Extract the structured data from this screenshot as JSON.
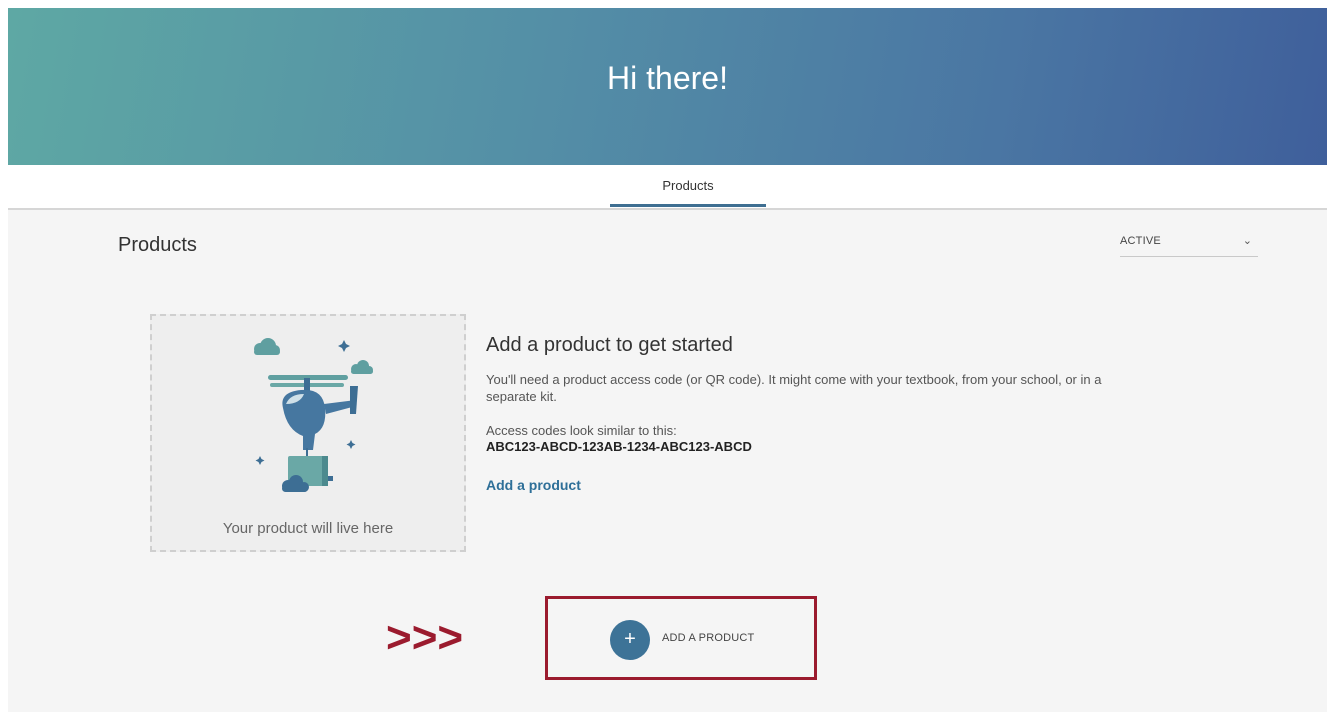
{
  "hero": {
    "title": "Hi there!"
  },
  "tabs": [
    {
      "label": "Products",
      "active": true
    }
  ],
  "section": {
    "title": "Products"
  },
  "filter": {
    "value": "ACTIVE",
    "icon": "chevron-down-icon"
  },
  "placeholder": {
    "caption": "Your product will live here",
    "illustration": "helicopter-illustration"
  },
  "info": {
    "heading": "Add a product to get started",
    "description": "You'll need a product access code (or QR code). It might come with your textbook, from your school, or in a separate kit.",
    "code_label": "Access codes look similar to this:",
    "code_example": "ABC123-ABCD-123AB-1234-ABC123-ABCD",
    "link_label": "Add a product"
  },
  "annotation": {
    "arrows": ">>>"
  },
  "add_button": {
    "icon": "+",
    "label": "ADD A PRODUCT"
  },
  "colors": {
    "accent": "#3d7397",
    "link": "#2e6f98",
    "highlight": "#9b1b2e",
    "hero_start": "#5ea8a4",
    "hero_end": "#3f5f9b"
  }
}
